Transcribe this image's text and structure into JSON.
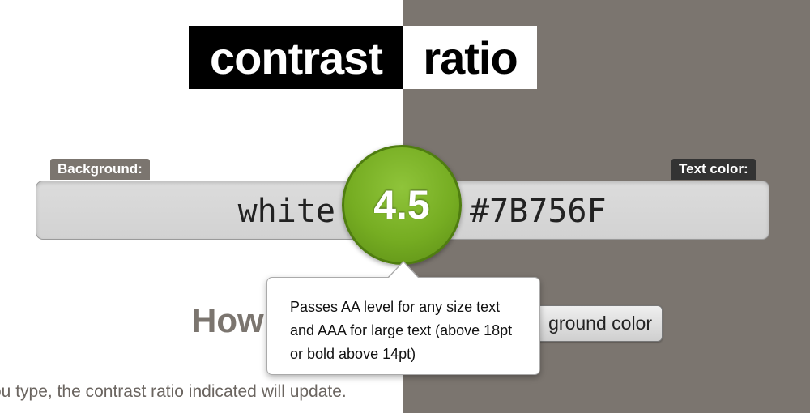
{
  "header": {
    "title_part1": "contrast",
    "title_part2": "ratio"
  },
  "background": {
    "label": "Background:",
    "value": "white"
  },
  "text_color": {
    "label": "Text color:",
    "value": "#7B756F"
  },
  "result": {
    "ratio": "4.5",
    "tooltip": "Passes AA level for any size text and AAA for large text (above 18pt or bold above 14pt)"
  },
  "main": {
    "heading": "How",
    "swap_button_label": "ground color",
    "description_line1": "ou type, the contrast ratio indicated will update.",
    "description_line2": ""
  },
  "colors": {
    "text_color": "#7B756F",
    "ratio_green": "#76ad22"
  }
}
